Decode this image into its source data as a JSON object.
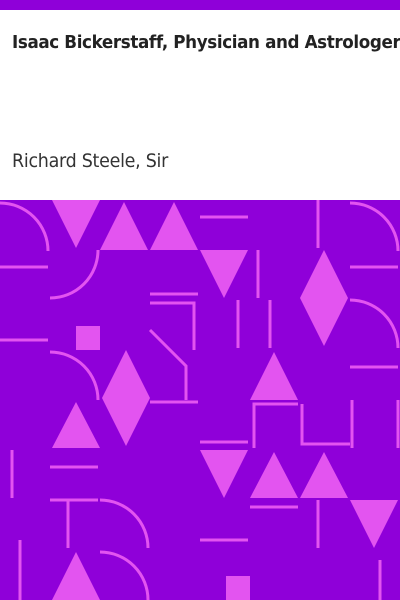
{
  "book": {
    "title": "Isaac Bickerstaff, Physician and Astrologer",
    "author": "Richard Steele, Sir"
  },
  "colors": {
    "top_bar": "#8f00d9",
    "pattern_background": "#8f00d9",
    "pattern_shapes": "#e354f0"
  }
}
